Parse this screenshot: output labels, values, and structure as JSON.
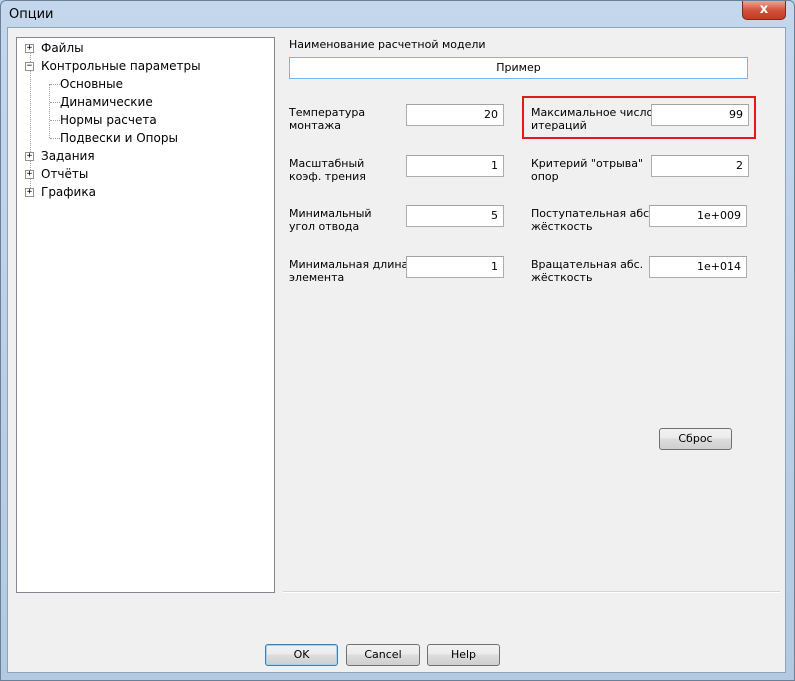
{
  "window": {
    "title": "Опции",
    "close_label": "x"
  },
  "tree": {
    "files": "Файлы",
    "control": "Контрольные параметры",
    "basic": "Основные",
    "dynamic": "Динамические",
    "norms": "Нормы расчета",
    "hangers": "Подвески и Опоры",
    "tasks": "Задания",
    "reports": "Отчёты",
    "graphics": "Графика",
    "plus": "+",
    "minus": "−"
  },
  "model": {
    "label": "Наименование расчетной модели",
    "value": "Пример"
  },
  "params": {
    "temp_label": "Температура\nмонтажа",
    "temp_value": "20",
    "friction_label": "Масштабный\nкоэф. трения",
    "friction_value": "1",
    "angle_label": "Минимальный\nугол отвода",
    "angle_value": "5",
    "length_label": "Минимальная длина\nэлемента",
    "length_value": "1",
    "iter_label": "Максимальное число\nитераций",
    "iter_value": "99",
    "lift_label": "Критерий \"отрыва\"\nопор",
    "lift_value": "2",
    "trans_label": "Поступательная абс.\nжёсткость",
    "trans_value": "1e+009",
    "rot_label": "Вращательная абс.\nжёсткость",
    "rot_value": "1e+014"
  },
  "buttons": {
    "reset": "Сброс",
    "ok": "OK",
    "cancel": "Cancel",
    "help": "Help"
  }
}
